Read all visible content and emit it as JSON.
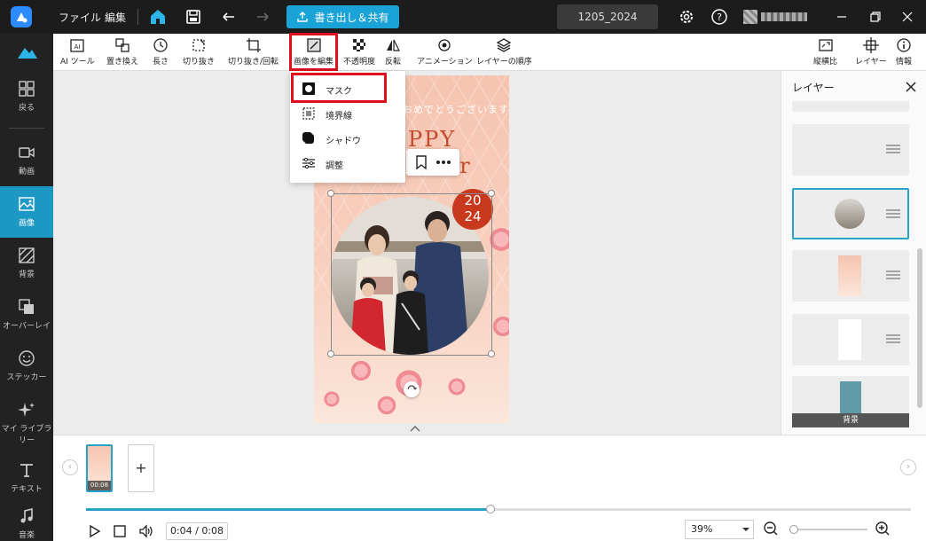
{
  "titlebar": {
    "menu_file": "ファイル",
    "menu_edit": "編集",
    "export_label": "書き出し＆共有",
    "project_name": "1205_2024"
  },
  "sidebar": {
    "items": [
      {
        "label": "戻る"
      },
      {
        "label": "動画"
      },
      {
        "label": "画像"
      },
      {
        "label": "背景"
      },
      {
        "label": "オーバーレイ"
      },
      {
        "label": "ステッカー"
      },
      {
        "label": "マイ ライブラリー"
      },
      {
        "label": "テキスト"
      },
      {
        "label": "音楽"
      }
    ]
  },
  "toolbar": {
    "ai_tool": "AI ツール",
    "replace": "置き換え",
    "length": "長さ",
    "crop": "切り抜き",
    "crop_rotate": "切り抜き/回転",
    "edit_image": "画像を編集",
    "opacity": "不透明度",
    "flip": "反転",
    "animation": "アニメーション",
    "layer_order": "レイヤーの順序",
    "aspect_ratio": "縦横比",
    "layers": "レイヤー",
    "info": "情報"
  },
  "dropdown": {
    "mask": "マスク",
    "border": "境界線",
    "shadow": "シャドウ",
    "adjust": "調整"
  },
  "poster": {
    "greeting": "おめでとうございます",
    "happy": "PPY",
    "year_word": "ar",
    "year_top": "20",
    "year_bottom": "24"
  },
  "layer_panel": {
    "title": "レイヤー",
    "background_label": "背景"
  },
  "timeline": {
    "clip_duration": "00:08",
    "add_clip": "+",
    "time": "0:04 / 0:08",
    "progress": 0.49,
    "zoom": "39%",
    "zoom_level": 0.0
  },
  "colors": {
    "accent": "#1d98c4",
    "highlight": "#e10f1e",
    "titlebar": "#1c1c1c",
    "sidebar": "#222222"
  }
}
